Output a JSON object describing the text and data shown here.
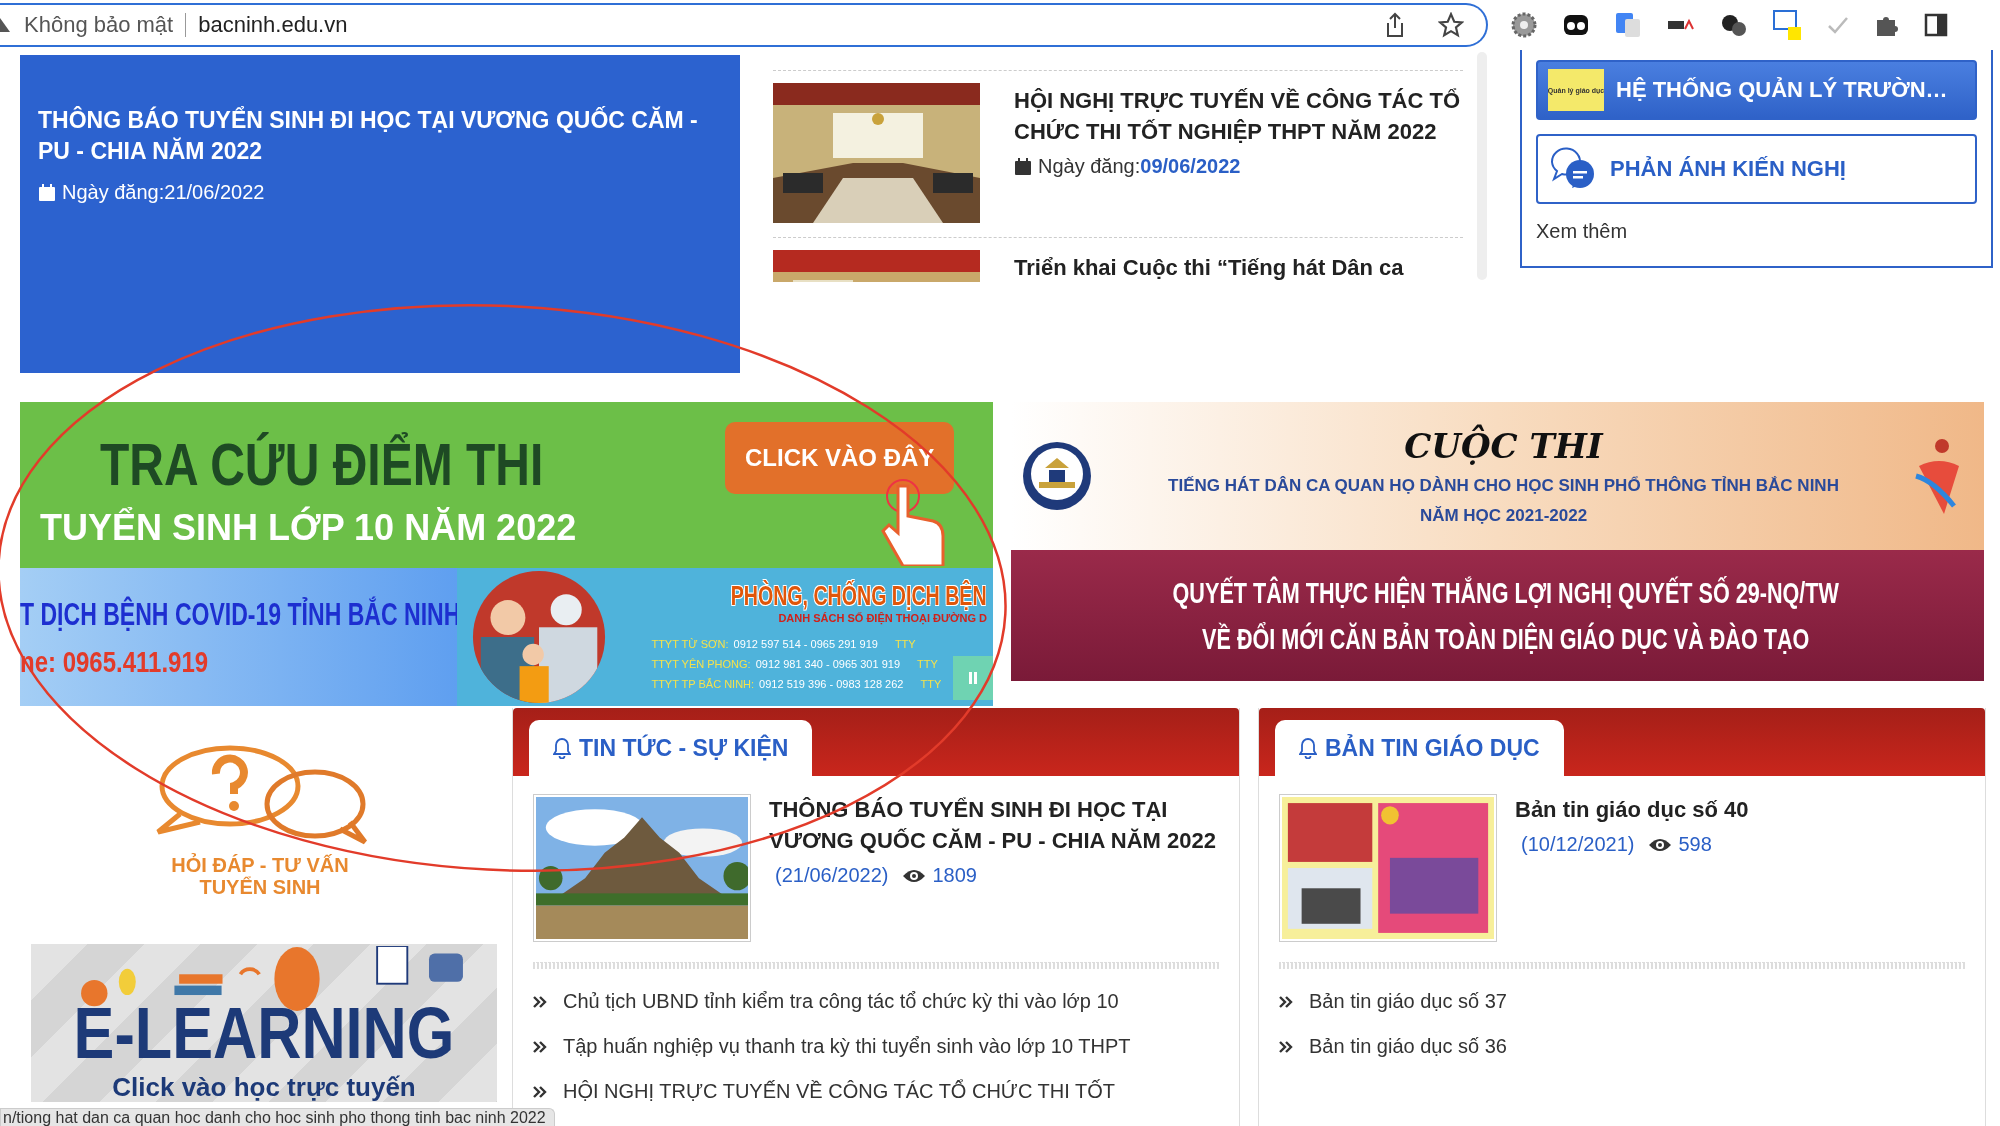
{
  "browser": {
    "security": "Không bảo mật",
    "url": "bacninh.edu.vn"
  },
  "featured": {
    "title": "THÔNG BÁO TUYỂN SINH ĐI HỌC TẠI VƯƠNG QUỐC CĂM - PU - CHIA NĂM 2022",
    "date": "Ngày đăng:21/06/2022"
  },
  "news_list": [
    {
      "title": "HỘI NGHỊ TRỰC TUYẾN VỀ CÔNG TÁC TỔ CHỨC THI TỐT NGHIỆP THPT NĂM 2022",
      "date_label": "Ngày đăng:",
      "date": "09/06/2022"
    },
    {
      "title": "Triển khai Cuộc thi “Tiếng hát Dân ca"
    }
  ],
  "quick_links": [
    {
      "kind": "filled",
      "thumb_text": "Quản lý giáo dục",
      "label": "HỆ THỐNG QUẢN LÝ TRƯỜN…"
    },
    {
      "kind": "outlined",
      "label": "PHẢN ÁNH KIẾN NGHỊ"
    }
  ],
  "more_link": "Xem thêm",
  "banner_exam": {
    "title": "TRA CỨU ĐIỂM THI",
    "button": "CLICK VÀO ĐÂY",
    "subtitle": "TUYỂN SINH LỚP 10 NĂM 2022"
  },
  "banner_covid": {
    "headline": "T DỊCH BỆNH COVID-19 TỈNH BẮC NINH",
    "hotline": "ne: 0965.411.919",
    "title": "PHÒNG, CHỐNG DỊCH BỆN",
    "subtitle": "DANH SÁCH SỐ ĐIỆN THOẠI ĐƯỜNG D",
    "phones": [
      {
        "unit": "TTYT TỪ SƠN:",
        "numbers": "0912 597 514 - 0965 291 919",
        "cut": "TTY"
      },
      {
        "unit": "TTYT YÊN PHONG:",
        "numbers": "0912 981 340 - 0965 301 919",
        "cut": "TTY"
      },
      {
        "unit": "TTYT TP BẮC NINH:",
        "numbers": "0912 519 396 - 0983 128 262",
        "cut": "TTY"
      }
    ]
  },
  "banner_contest": {
    "title": "CUỘC THI",
    "subtitle": "TIẾNG HÁT DÂN CA QUAN HỌ DÀNH CHO HỌC SINH PHỔ THÔNG TỈNH BẮC NINH",
    "year": "NĂM HỌC 2021-2022"
  },
  "banner_resolution": {
    "line_1": "QUYẾT TÂM THỰC HIỆN THẮNG LỢI NGHỊ QUYẾT SỐ 29-NQ/TW",
    "line_2": "VỀ ĐỔI MỚI CĂN BẢN TOÀN DIỆN GIÁO DỤC VÀ ĐÀO TẠO"
  },
  "qa_logo": {
    "line_1": "HỎI ĐÁP - TƯ VẤN",
    "line_2": "TUYỂN SINH"
  },
  "elearning": {
    "title": "E-LEARNING",
    "subtitle": "Click vào học trực tuyến"
  },
  "panels": [
    {
      "title": "TIN TỨC - SỰ KIỆN",
      "featured": {
        "title": "THÔNG BÁO TUYỂN SINH ĐI HỌC TẠI VƯƠNG QUỐC CĂM - PU - CHIA NĂM 2022",
        "date": "(21/06/2022)",
        "views": "1809"
      },
      "items": [
        "Chủ tịch UBND tỉnh kiểm tra công tác tổ chức kỳ thi vào lớp 10",
        "Tập huấn nghiệp vụ thanh tra kỳ thi tuyển sinh vào lớp 10 THPT",
        "HỘI NGHỊ TRỰC TUYẾN VỀ CÔNG TÁC TỔ CHỨC THI TỐT"
      ]
    },
    {
      "title": "BẢN TIN GIÁO DỤC",
      "featured": {
        "title": "Bản tin giáo dục số 40",
        "date": "(10/12/2021)",
        "views": "598"
      },
      "items": [
        "Bản tin giáo dục số 37",
        "Bản tin giáo dục số 36"
      ]
    }
  ],
  "status_url": "n/tiong hat dan ca quan hoc danh cho hoc sinh pho thong tinh bac ninh 2022"
}
